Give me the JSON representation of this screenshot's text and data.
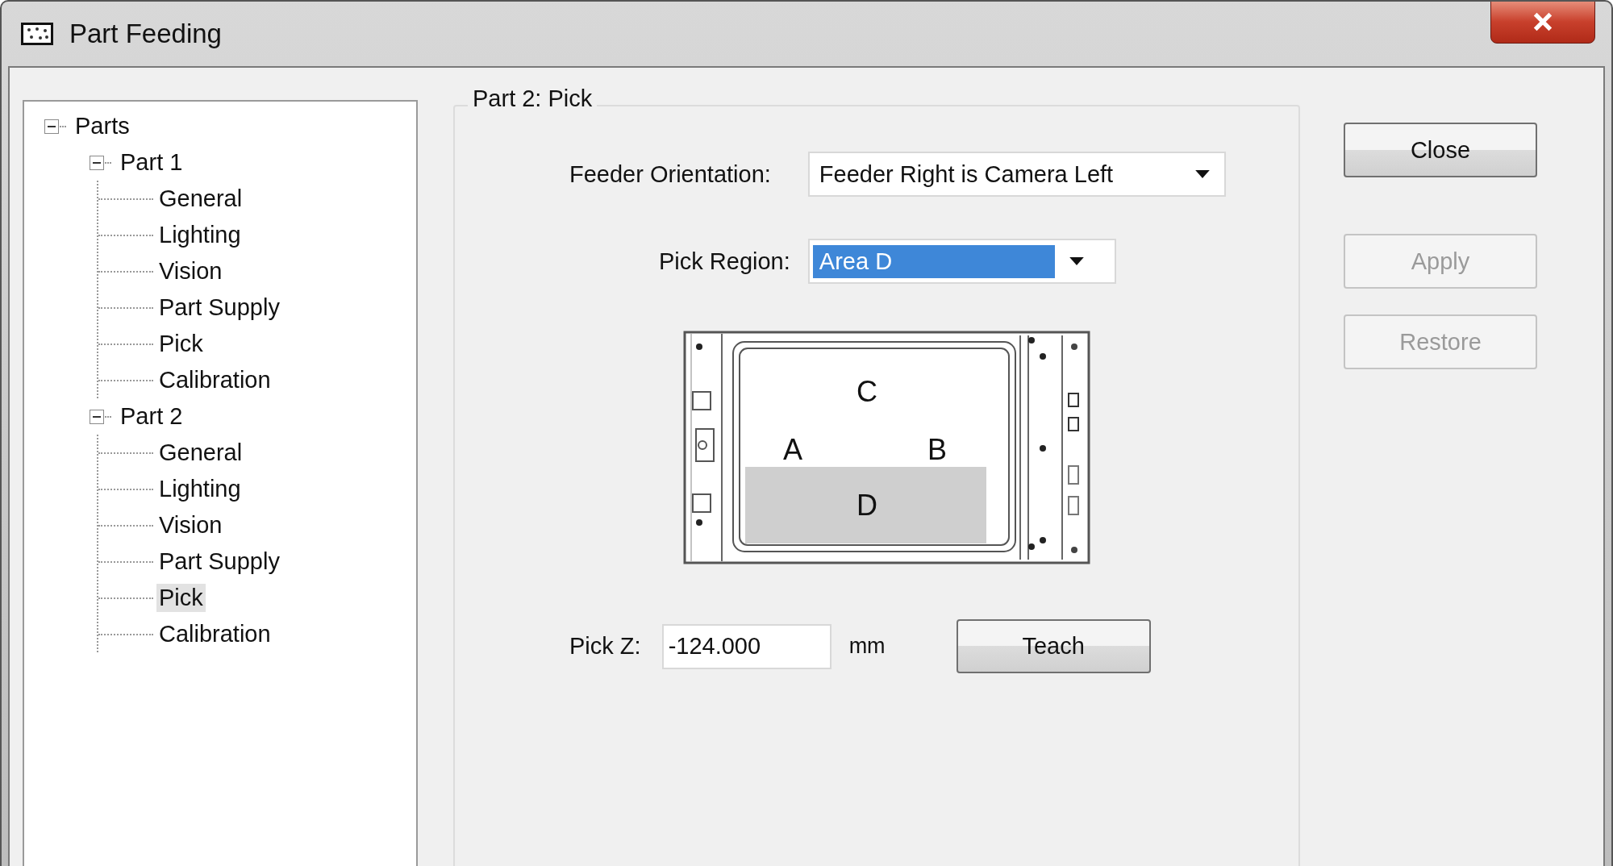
{
  "window": {
    "title": "Part Feeding"
  },
  "tree": {
    "label": "Parts",
    "expanded": true,
    "children": [
      {
        "label": "Part 1",
        "expanded": true,
        "children": [
          {
            "label": "General",
            "selected": false
          },
          {
            "label": "Lighting",
            "selected": false
          },
          {
            "label": "Vision",
            "selected": false
          },
          {
            "label": "Part Supply",
            "selected": false
          },
          {
            "label": "Pick",
            "selected": false
          },
          {
            "label": "Calibration",
            "selected": false
          }
        ]
      },
      {
        "label": "Part 2",
        "expanded": true,
        "children": [
          {
            "label": "General",
            "selected": false
          },
          {
            "label": "Lighting",
            "selected": false
          },
          {
            "label": "Vision",
            "selected": false
          },
          {
            "label": "Part Supply",
            "selected": false
          },
          {
            "label": "Pick",
            "selected": true
          },
          {
            "label": "Calibration",
            "selected": false
          }
        ]
      }
    ]
  },
  "group": {
    "title": "Part 2: Pick",
    "feeder_orientation": {
      "label": "Feeder Orientation:",
      "value": "Feeder Right is Camera Left",
      "highlighted": false
    },
    "pick_region": {
      "label": "Pick Region:",
      "value": "Area D",
      "highlighted": true
    },
    "regions": [
      {
        "label": "C",
        "selected": false
      },
      {
        "label": "A",
        "selected": false
      },
      {
        "label": "B",
        "selected": false
      },
      {
        "label": "D",
        "selected": true
      }
    ],
    "pick_z": {
      "label": "Pick Z:",
      "value": "-124.000",
      "unit": "mm"
    },
    "teach_button": {
      "label": "Teach",
      "disabled": false
    }
  },
  "buttons": [
    {
      "label": "Close",
      "disabled": false
    },
    {
      "label": "Apply",
      "disabled": true
    },
    {
      "label": "Restore",
      "disabled": true
    }
  ]
}
